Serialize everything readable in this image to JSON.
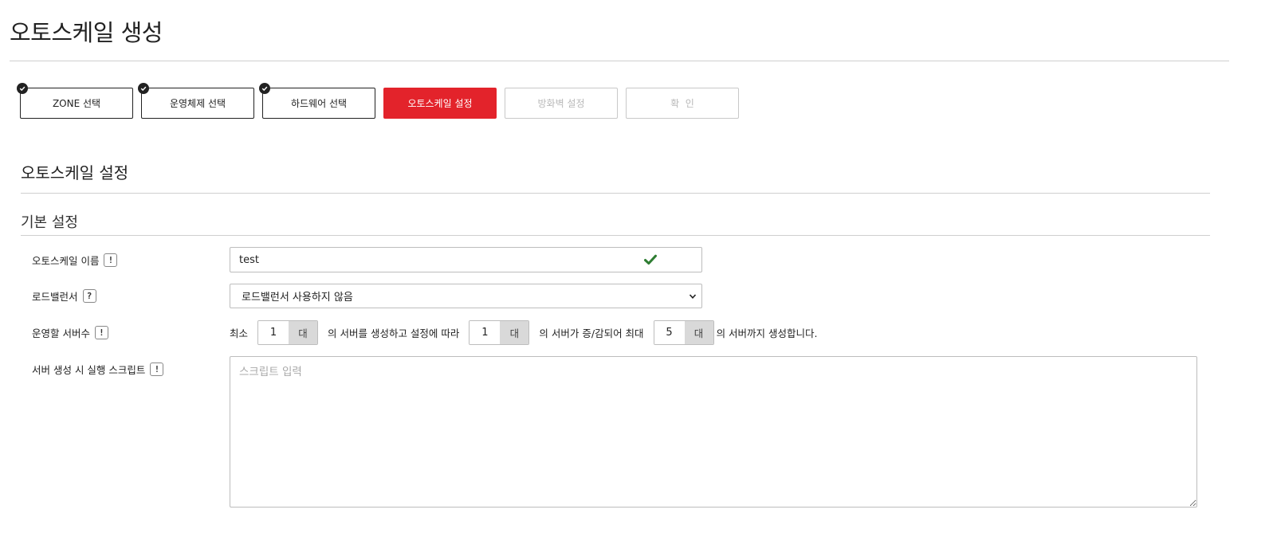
{
  "page": {
    "title": "오토스케일 생성"
  },
  "steps": [
    {
      "label": "ZONE 선택",
      "state": "completed"
    },
    {
      "label": "운영체제 선택",
      "state": "completed"
    },
    {
      "label": "하드웨어 선택",
      "state": "completed"
    },
    {
      "label": "오토스케일 설정",
      "state": "active"
    },
    {
      "label": "방화벽 설정",
      "state": "disabled"
    },
    {
      "label": "확  인",
      "state": "disabled"
    }
  ],
  "section": {
    "title": "오토스케일 설정",
    "subtitle": "기본 설정"
  },
  "form": {
    "name": {
      "label": "오토스케일 이름",
      "info_icon": "!",
      "value": "test",
      "valid": true
    },
    "load_balancer": {
      "label": "로드밸런서",
      "info_icon": "?",
      "selected": "로드밸런서 사용하지 않음"
    },
    "servers": {
      "label": "운영할 서버수",
      "info_icon": "!",
      "min_prefix": "최소",
      "min_value": "1",
      "unit": "대",
      "text_after_min": "의 서버를 생성하고 설정에 따라",
      "step_value": "1",
      "text_after_step": "의 서버가 증/감되어 최대",
      "max_value": "5",
      "text_end": "의 서버까지 생성합니다."
    },
    "script": {
      "label": "서버 생성 시 실행 스크립트",
      "info_icon": "!",
      "placeholder": "스크립트 입력",
      "value": ""
    }
  },
  "colors": {
    "accent": "#e3232b",
    "valid_check": "#2e7d32",
    "border": "#bdbdbd",
    "unit_bg": "#d9d9d9"
  }
}
